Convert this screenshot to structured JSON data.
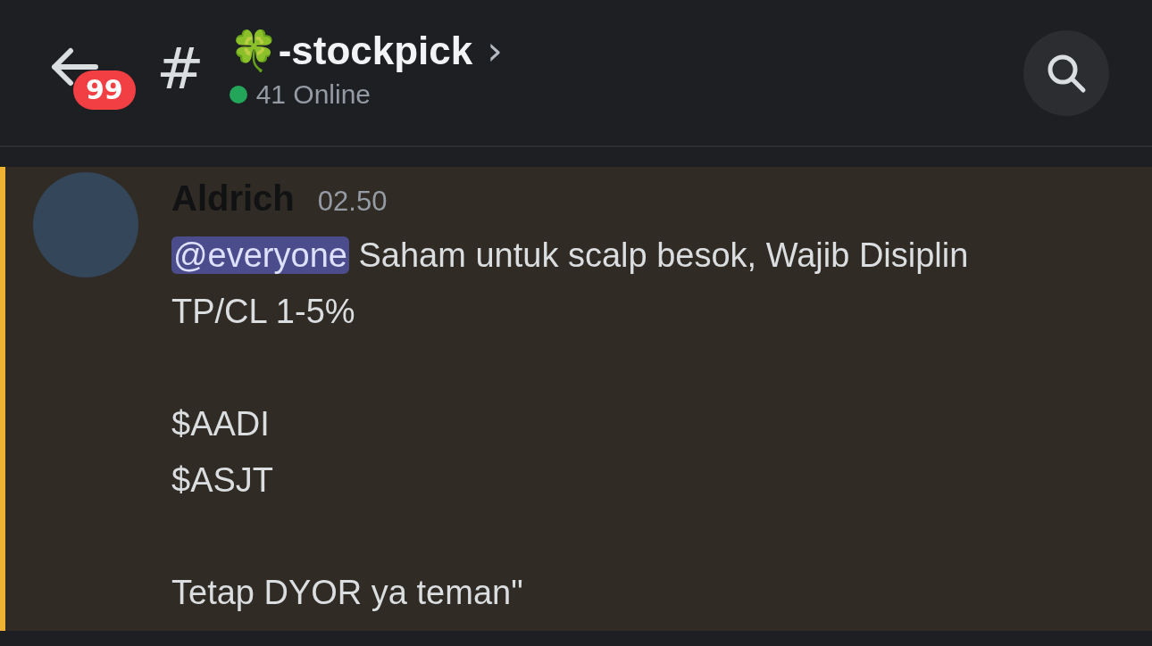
{
  "header": {
    "unread_badge": "99",
    "channel_prefix": "#",
    "channel_name": "🍀-stockpick",
    "chevron": "›",
    "online": "41 Online"
  },
  "message": {
    "author": "Aldrich",
    "time": "02.50",
    "mentioned": true,
    "mention": "@everyone",
    "first_text": "Saham untuk scalp besok, Wajib Disiplin TP/CL 1-5%",
    "paragraphs": [
      {
        "lines": [
          "$AADI",
          "$ASJT"
        ]
      },
      {
        "lines": [
          "Tetap DYOR ya teman\""
        ]
      }
    ]
  }
}
